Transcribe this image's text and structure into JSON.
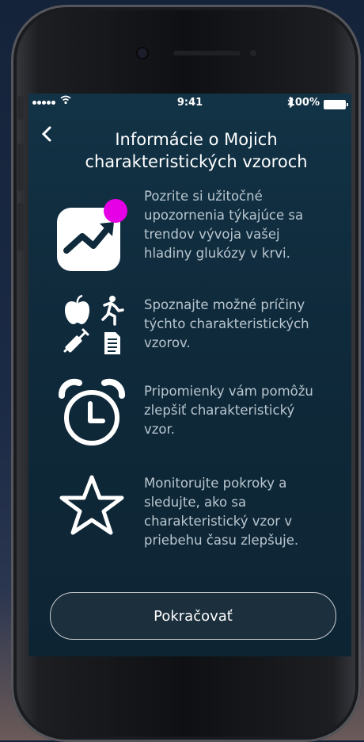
{
  "status_bar": {
    "time": "9:41",
    "battery": "100%"
  },
  "header": {
    "back_icon": "chevron-left-icon",
    "title": "Informácie o Mojich charakteristických vzoroch"
  },
  "features": [
    {
      "icon": "trend-notification-icon",
      "text": "Pozrite si užitočné upozornenia týkajúce sa trendov vývoja vašej hladiny glukózy v krvi."
    },
    {
      "icon": "causes-icons",
      "text": "Spoznajte možné príčiny týchto charakteristických vzorov."
    },
    {
      "icon": "alarm-clock-icon",
      "text": "Pripomienky vám pomôžu zlepšiť charakteristický vzor."
    },
    {
      "icon": "star-icon",
      "text": "Monitorujte pokroky a sledujte, ako sa charakteristický vzor v priebehu času zlepšuje."
    }
  ],
  "button": {
    "label": "Pokračovať"
  },
  "colors": {
    "accent_badge": "#e600e6",
    "text_secondary": "#b9c6cf",
    "screen_bg": "#0f2a3b"
  }
}
